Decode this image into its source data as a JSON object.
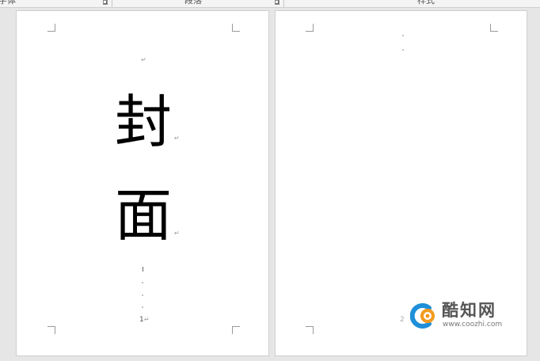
{
  "ribbon": {
    "groups": [
      {
        "label": "字体"
      },
      {
        "label": "段落"
      },
      {
        "label": "样式"
      }
    ]
  },
  "document": {
    "page1": {
      "cover_chars": [
        "封",
        "面"
      ],
      "page_number": "1"
    },
    "page2": {
      "page_number": "2"
    },
    "paragraph_mark": "↵"
  },
  "watermark": {
    "title": "酷知网",
    "url": "www.coozhi.com",
    "colors": {
      "blue": "#1e8fd8",
      "orange": "#f39a1e"
    }
  }
}
